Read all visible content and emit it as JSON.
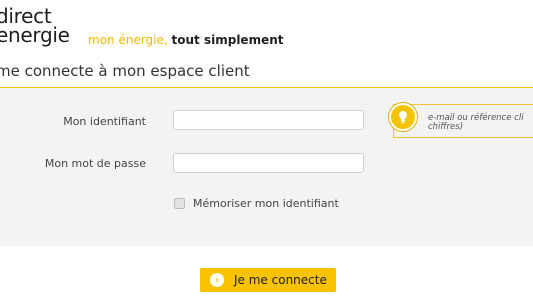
{
  "brand": {
    "line1": "direct",
    "line2": "energie",
    "tagline_highlight": "mon énergie,",
    "tagline_rest": "tout simplement"
  },
  "page": {
    "heading": "me connecte à mon espace client"
  },
  "form": {
    "id_label": "Mon identifiant",
    "id_value": "",
    "password_label": "Mon mot de passe",
    "password_value": "",
    "remember_label": "Mémoriser mon identifiant",
    "remember_checked": false,
    "hint_line1": "e-mail ou référence cli",
    "hint_line2": "chiffres)",
    "submit_label": "Je me connecte",
    "submit_icon": "chevron-right-icon"
  },
  "colors": {
    "accent": "#f7c200",
    "text": "#1f1f1f",
    "panel_bg": "#f3f3f3"
  }
}
